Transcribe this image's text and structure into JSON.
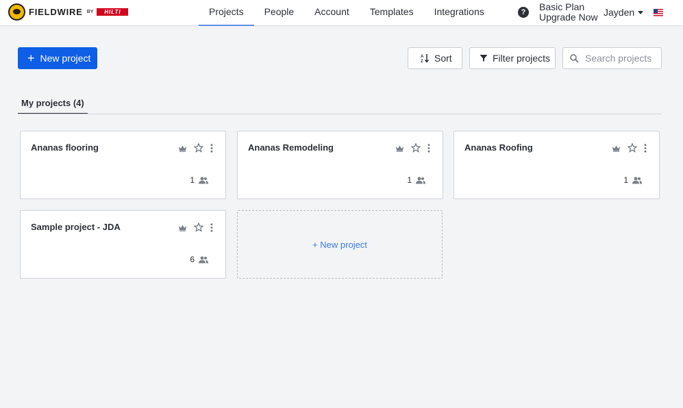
{
  "header": {
    "brand": "FIELDWIRE",
    "brand_by": "BY",
    "partner": "HILTI",
    "nav": [
      "Projects",
      "People",
      "Account",
      "Templates",
      "Integrations"
    ],
    "active_nav": "Projects",
    "plan_name": "Basic Plan",
    "plan_cta": "Upgrade Now",
    "user_name": "Jayden",
    "help_icon": "question-circle-icon",
    "flag_icon": "us-flag-icon"
  },
  "toolbar": {
    "new_project_label": "New project",
    "sort_label": "Sort",
    "filter_label": "Filter projects",
    "search_placeholder": "Search projects"
  },
  "tabs": {
    "my_projects": "My projects (4)"
  },
  "projects": [
    {
      "name": "Ananas flooring",
      "members": "1"
    },
    {
      "name": "Ananas Remodeling",
      "members": "1"
    },
    {
      "name": "Ananas Roofing",
      "members": "1"
    },
    {
      "name": "Sample project - JDA",
      "members": "6"
    }
  ],
  "new_project_card": "+ New project",
  "colors": {
    "primary": "#0e5ee6",
    "link": "#3a7be0",
    "background": "#f3f4f6",
    "hilti_red": "#d2051e"
  }
}
